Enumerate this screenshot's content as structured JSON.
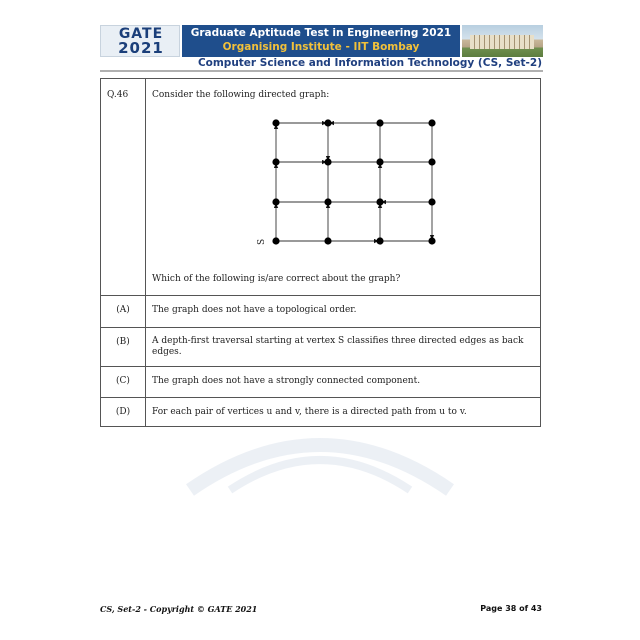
{
  "header": {
    "logo_line1": "GATE",
    "logo_line2": "2021",
    "title_line1": "Graduate Aptitude Test in Engineering 2021",
    "title_line2": "Organising Institute - IIT Bombay",
    "subtitle": "Computer Science and Information Technology (CS, Set-2)"
  },
  "question": {
    "number": "Q.46",
    "stem": "Consider the following directed graph:",
    "start_label": "S",
    "prompt": "Which of the following is/are correct about the graph?",
    "options": [
      {
        "label": "(A)",
        "text": "The graph does not have a topological order."
      },
      {
        "label": "(B)",
        "text": "A depth-first traversal starting at vertex  S classifies three directed edges as back edges."
      },
      {
        "label": "(C)",
        "text": "The graph does not have a strongly connected component."
      },
      {
        "label": "(D)",
        "text": "For each pair of vertices u and v, there is a directed path from u to v."
      }
    ]
  },
  "footer": {
    "left": "CS, Set-2 - Copyright © GATE 2021",
    "right": "Page 38 of 43"
  }
}
